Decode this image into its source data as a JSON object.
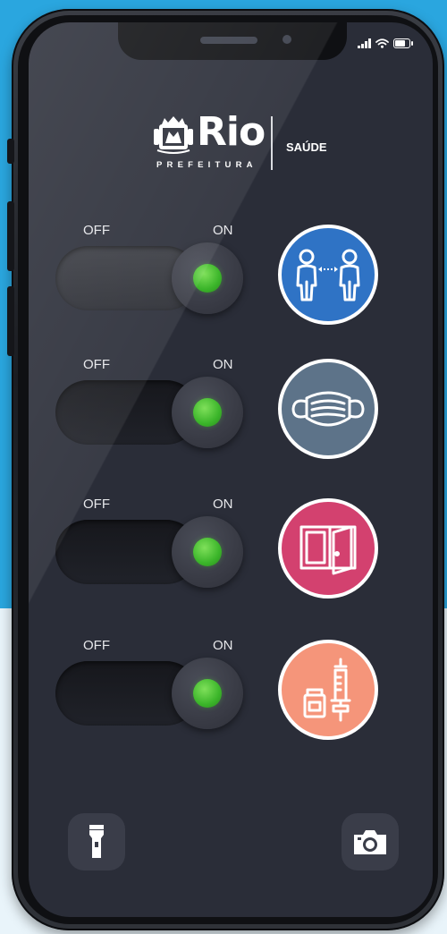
{
  "brand": {
    "name": "Rio",
    "subtitle": "PREFEITURA",
    "section": "SAÚDE"
  },
  "colors": {
    "distance": "#2f73c5",
    "mask": "#5d7389",
    "ventilation": "#d3416f",
    "vaccine": "#f5957a",
    "led_on": "#3bb52a"
  },
  "toggles": [
    {
      "off_label": "OFF",
      "on_label": "ON",
      "state": "on",
      "icon": "social-distance-icon"
    },
    {
      "off_label": "OFF",
      "on_label": "ON",
      "state": "on",
      "icon": "face-mask-icon"
    },
    {
      "off_label": "OFF",
      "on_label": "ON",
      "state": "on",
      "icon": "open-window-icon"
    },
    {
      "off_label": "OFF",
      "on_label": "ON",
      "state": "on",
      "icon": "vaccine-icon"
    }
  ],
  "bottom_bar": {
    "left_icon": "flashlight-icon",
    "right_icon": "camera-icon"
  }
}
